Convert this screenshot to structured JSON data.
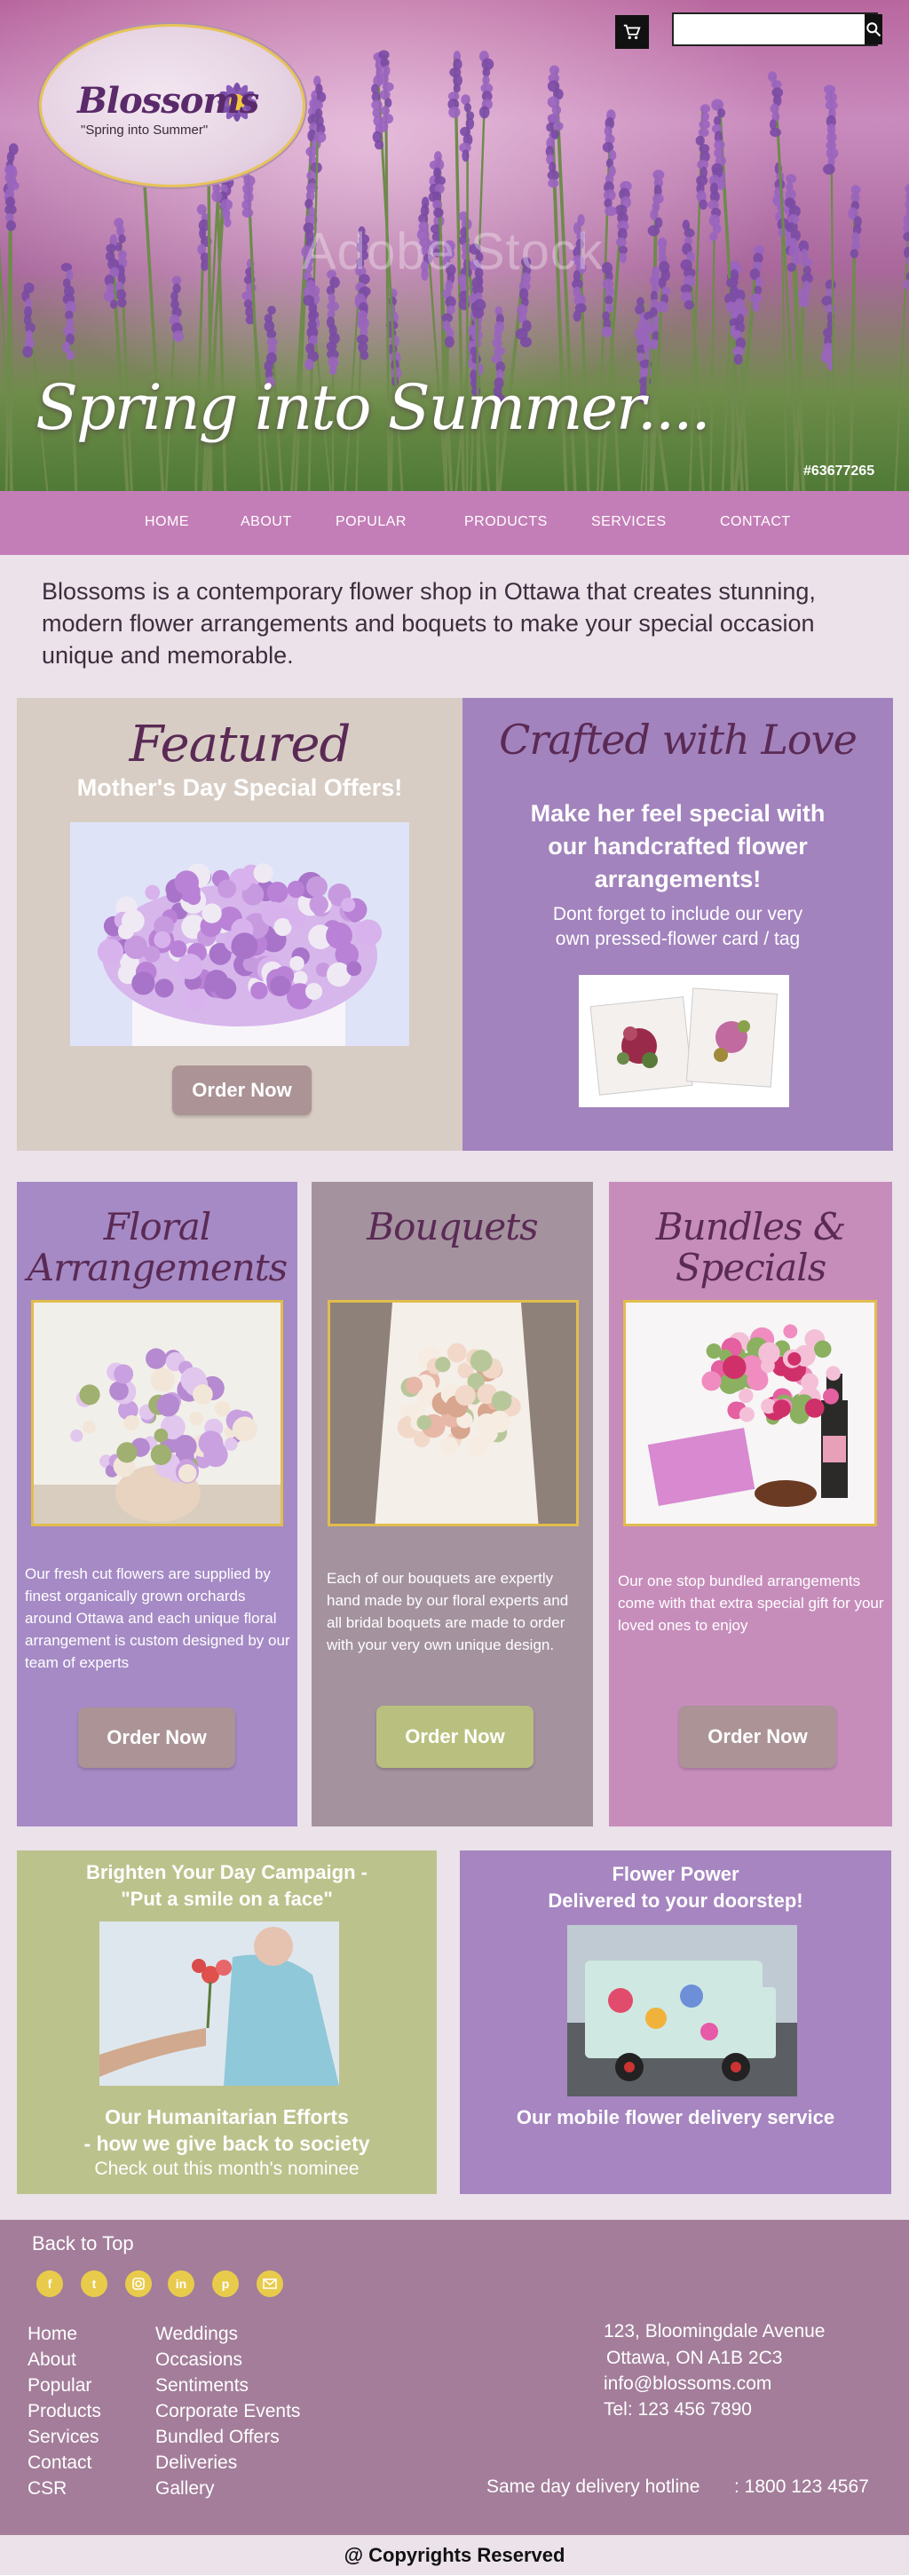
{
  "header": {
    "cart_icon": "cart-icon",
    "search": {
      "placeholder": "",
      "value": "",
      "icon": "search-icon"
    }
  },
  "logo": {
    "brand": "Blossoms",
    "tagline": "\"Spring into Summer\""
  },
  "hero": {
    "title": "Spring into Summer....",
    "watermark": "Adobe Stock",
    "stock_id": "#63677265"
  },
  "nav": {
    "items": [
      {
        "label": "HOME"
      },
      {
        "label": "ABOUT"
      },
      {
        "label": "POPULAR"
      },
      {
        "label": "PRODUCTS"
      },
      {
        "label": "SERVICES"
      },
      {
        "label": "CONTACT"
      }
    ]
  },
  "intro": "Blossoms is a contemporary flower shop in Ottawa that creates stunning, modern flower arrangements and boquets to make your special occasion unique and memorable.",
  "featured": {
    "title": "Featured",
    "subtitle": "Mother's Day Special Offers!",
    "button": "Order Now"
  },
  "crafted": {
    "title": "Crafted with Love",
    "headline": "Make her feel special with our handcrafted flower arrangements!",
    "note_line1": "Dont forget to include our very",
    "note_line2": "own pressed-flower card / tag"
  },
  "products": [
    {
      "title_line1": "Floral",
      "title_line2": "Arrangements",
      "description": "Our fresh cut flowers are supplied by finest organically grown orchards around Ottawa and each  unique floral arrangement is custom designed by our team of experts",
      "button": "Order Now"
    },
    {
      "title_line1": "Bouquets",
      "title_line2": "",
      "description": "Each of our bouquets are expertly hand made by  our floral experts and all bridal boquets are made to order with your very own  unique  design.",
      "button": "Order Now"
    },
    {
      "title_line1": "Bundles &",
      "title_line2": "Specials",
      "description": "Our one stop bundled arrangements come with that extra special gift for your loved ones to enjoy",
      "button": "Order Now"
    }
  ],
  "campaign": {
    "title_line1": "Brighten Your Day Campaign -",
    "title_line2": "\"Put a smile on a face\"",
    "efforts_line1": "Our Humanitarian Efforts",
    "efforts_line2": "- how we give back to society",
    "nominee": "Check out this month's nominee"
  },
  "delivery": {
    "title_line1": "Flower Power",
    "title_line2": "Delivered to your doorstep!",
    "caption": "Our mobile flower delivery service"
  },
  "footer": {
    "back_to_top": "Back to Top",
    "social": [
      "facebook-icon",
      "twitter-icon",
      "instagram-icon",
      "linkedin-icon",
      "pinterest-icon",
      "email-icon"
    ],
    "links_col1": [
      "Home",
      "About",
      "Popular",
      "Products",
      "Services",
      "Contact",
      "CSR"
    ],
    "links_col2": [
      "Weddings",
      "Occasions",
      "Sentiments",
      "Corporate Events",
      "Bundled Offers",
      "Deliveries",
      "Gallery"
    ],
    "address1": "123, Bloomingdale Avenue",
    "address2": "Ottawa, ON  A1B 2C3",
    "email": "info@blossoms.com",
    "tel": "Tel: 123 456 7890",
    "hotline_label": "Same day delivery hotline",
    "hotline_number": ": 1800 123 4567"
  },
  "copyright": "@ Copyrights Reserved",
  "colors": {
    "nav": "#c37eb7",
    "featured_bg": "#d8cdc4",
    "crafted_bg": "#a283bd",
    "floral_bg": "#a58ac5",
    "bouquets_bg": "#a4929e",
    "bundles_bg": "#c68dbb",
    "campaign_bg": "#bcc28c",
    "delivery_bg": "#a685c0",
    "footer_bg": "#a37d9a",
    "order_taupe": "#ab9396",
    "order_green": "#b9c07f",
    "gold": "#e1bd4d"
  }
}
